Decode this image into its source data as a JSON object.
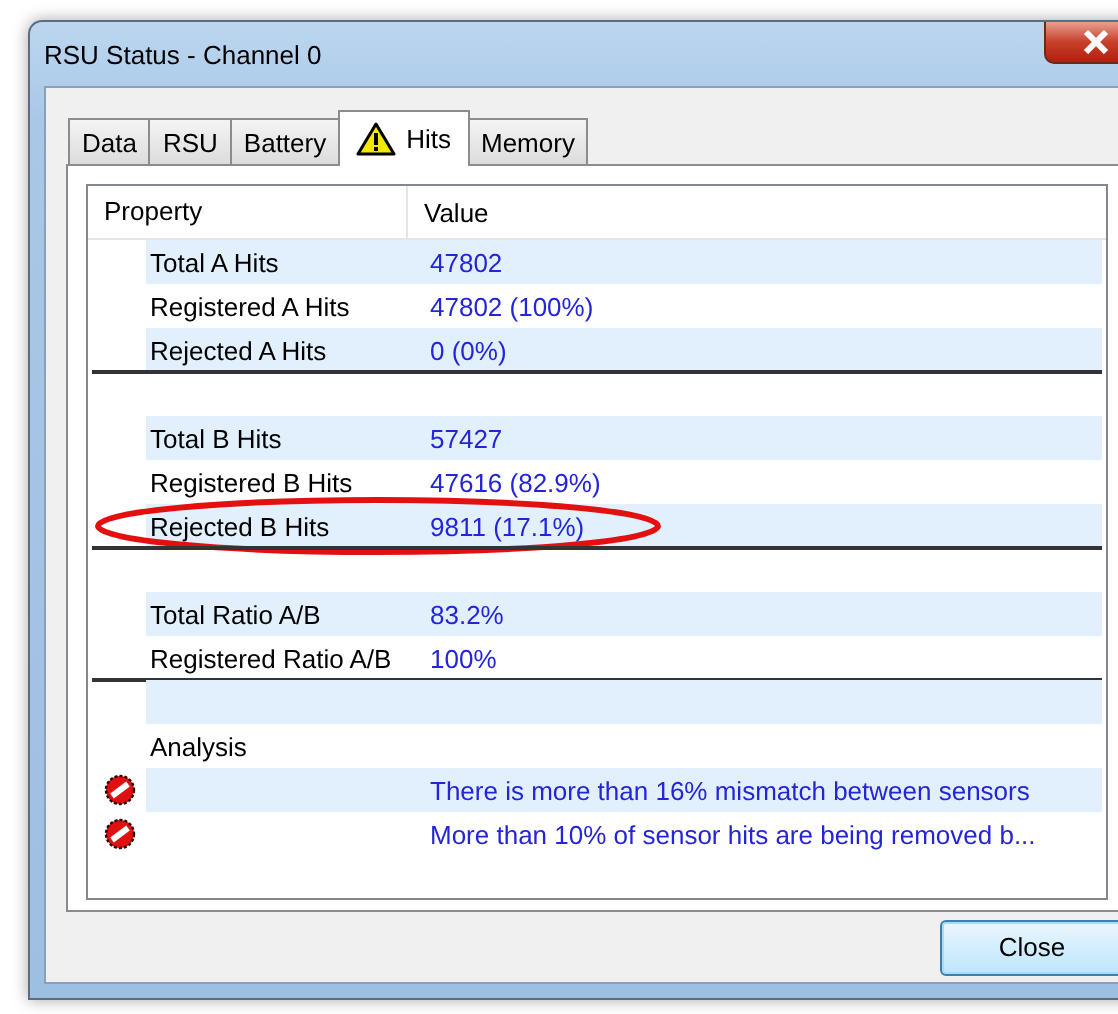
{
  "window": {
    "title": "RSU Status - Channel 0"
  },
  "tabs": [
    {
      "label": "Data",
      "selected": false,
      "kind": "plain"
    },
    {
      "label": "RSU",
      "selected": false,
      "kind": "plain"
    },
    {
      "label": "Battery",
      "selected": false,
      "kind": "plain"
    },
    {
      "label": "Hits",
      "selected": true,
      "kind": "warning"
    },
    {
      "label": "Memory",
      "selected": false,
      "kind": "plain"
    }
  ],
  "table": {
    "columns": [
      "Property",
      "Value"
    ],
    "rows": [
      {
        "kind": "property",
        "property": "Total A Hits",
        "value": "47802",
        "highlighted": false
      },
      {
        "kind": "property",
        "property": "Registered A Hits",
        "value": "47802 (100%)",
        "highlighted": false
      },
      {
        "kind": "property",
        "property": "Rejected A Hits",
        "value": "0 (0%)",
        "highlighted": false
      },
      {
        "kind": "separator"
      },
      {
        "kind": "blank"
      },
      {
        "kind": "property",
        "property": "Total B Hits",
        "value": "57427",
        "highlighted": false
      },
      {
        "kind": "property",
        "property": "Registered B Hits",
        "value": "47616 (82.9%)",
        "highlighted": false
      },
      {
        "kind": "property",
        "property": "Rejected B Hits",
        "value": "9811 (17.1%)",
        "highlighted": true
      },
      {
        "kind": "separator"
      },
      {
        "kind": "blank"
      },
      {
        "kind": "property",
        "property": "Total Ratio A/B",
        "value": "83.2%",
        "highlighted": false
      },
      {
        "kind": "property",
        "property": "Registered Ratio A/B",
        "value": "100%",
        "highlighted": false
      },
      {
        "kind": "separator"
      },
      {
        "kind": "blank"
      },
      {
        "kind": "heading",
        "property": "Analysis"
      },
      {
        "kind": "error",
        "value": "There is more than 16% mismatch between sensors"
      },
      {
        "kind": "error",
        "value": "More than 10% of sensor hits are being removed b..."
      }
    ]
  },
  "buttons": [
    "Close"
  ]
}
